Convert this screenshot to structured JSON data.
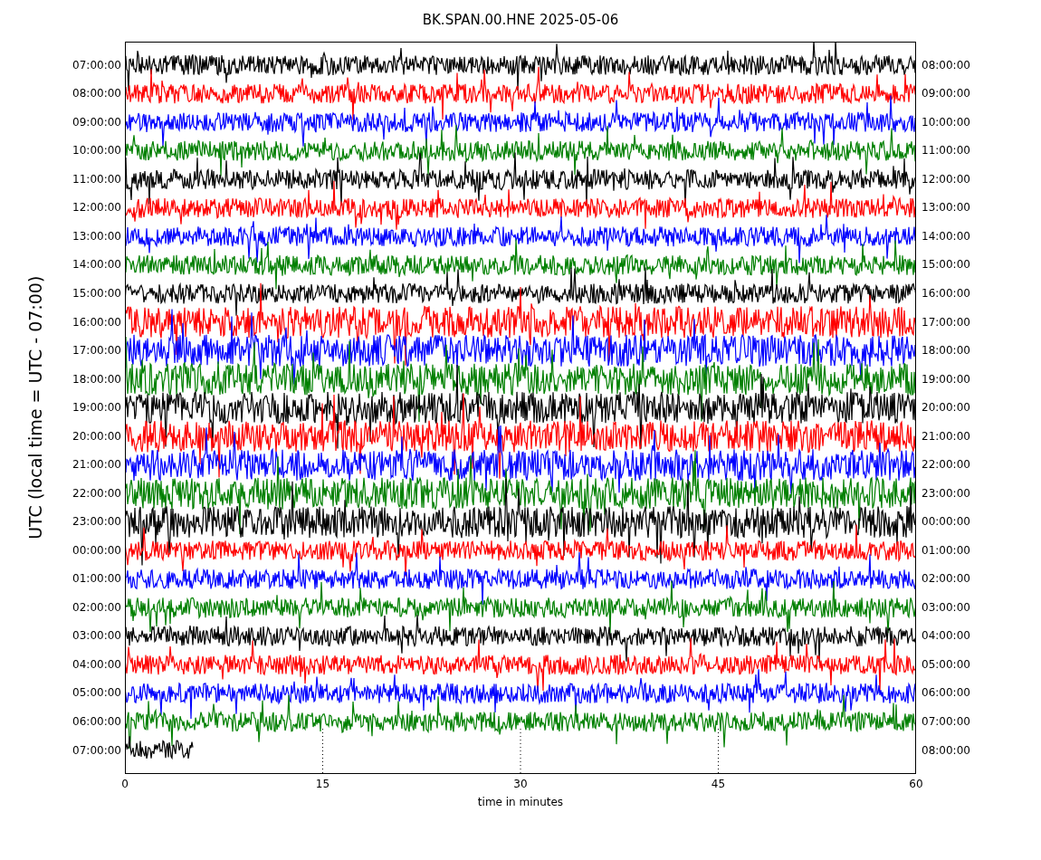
{
  "title": "BK.SPAN.00.HNE 2025-05-06",
  "ylabel": "UTC (local time = UTC - 07:00)",
  "xlabel": "time in minutes",
  "xticks": [
    "0",
    "15",
    "30",
    "45",
    "60"
  ],
  "rows": [
    {
      "left": "07:00:00",
      "right": "08:00:00",
      "color": "#000000",
      "kind": "full"
    },
    {
      "left": "08:00:00",
      "right": "09:00:00",
      "color": "#ff0000",
      "kind": "full"
    },
    {
      "left": "09:00:00",
      "right": "10:00:00",
      "color": "#0000ff",
      "kind": "full"
    },
    {
      "left": "10:00:00",
      "right": "11:00:00",
      "color": "#008000",
      "kind": "full"
    },
    {
      "left": "11:00:00",
      "right": "12:00:00",
      "color": "#000000",
      "kind": "full"
    },
    {
      "left": "12:00:00",
      "right": "13:00:00",
      "color": "#ff0000",
      "kind": "full"
    },
    {
      "left": "13:00:00",
      "right": "14:00:00",
      "color": "#0000ff",
      "kind": "full"
    },
    {
      "left": "14:00:00",
      "right": "15:00:00",
      "color": "#008000",
      "kind": "full"
    },
    {
      "left": "15:00:00",
      "right": "16:00:00",
      "color": "#000000",
      "kind": "full"
    },
    {
      "left": "16:00:00",
      "right": "17:00:00",
      "color": "#ff0000",
      "kind": "full"
    },
    {
      "left": "17:00:00",
      "right": "18:00:00",
      "color": "#0000ff",
      "kind": "full"
    },
    {
      "left": "18:00:00",
      "right": "19:00:00",
      "color": "#008000",
      "kind": "full"
    },
    {
      "left": "19:00:00",
      "right": "20:00:00",
      "color": "#000000",
      "kind": "full"
    },
    {
      "left": "20:00:00",
      "right": "21:00:00",
      "color": "#ff0000",
      "kind": "full"
    },
    {
      "left": "21:00:00",
      "right": "22:00:00",
      "color": "#0000ff",
      "kind": "full"
    },
    {
      "left": "22:00:00",
      "right": "23:00:00",
      "color": "#008000",
      "kind": "full"
    },
    {
      "left": "23:00:00",
      "right": "00:00:00",
      "color": "#000000",
      "kind": "full"
    },
    {
      "left": "00:00:00",
      "right": "01:00:00",
      "color": "#ff0000",
      "kind": "full"
    },
    {
      "left": "01:00:00",
      "right": "02:00:00",
      "color": "#0000ff",
      "kind": "full"
    },
    {
      "left": "02:00:00",
      "right": "03:00:00",
      "color": "#008000",
      "kind": "full"
    },
    {
      "left": "03:00:00",
      "right": "04:00:00",
      "color": "#000000",
      "kind": "full"
    },
    {
      "left": "04:00:00",
      "right": "05:00:00",
      "color": "#ff0000",
      "kind": "full"
    },
    {
      "left": "05:00:00",
      "right": "06:00:00",
      "color": "#0000ff",
      "kind": "full"
    },
    {
      "left": "06:00:00",
      "right": "07:00:00",
      "color": "#008000",
      "kind": "full"
    },
    {
      "left": "07:00:00",
      "right": "08:00:00",
      "color": "#000000",
      "kind": "partial"
    }
  ]
}
